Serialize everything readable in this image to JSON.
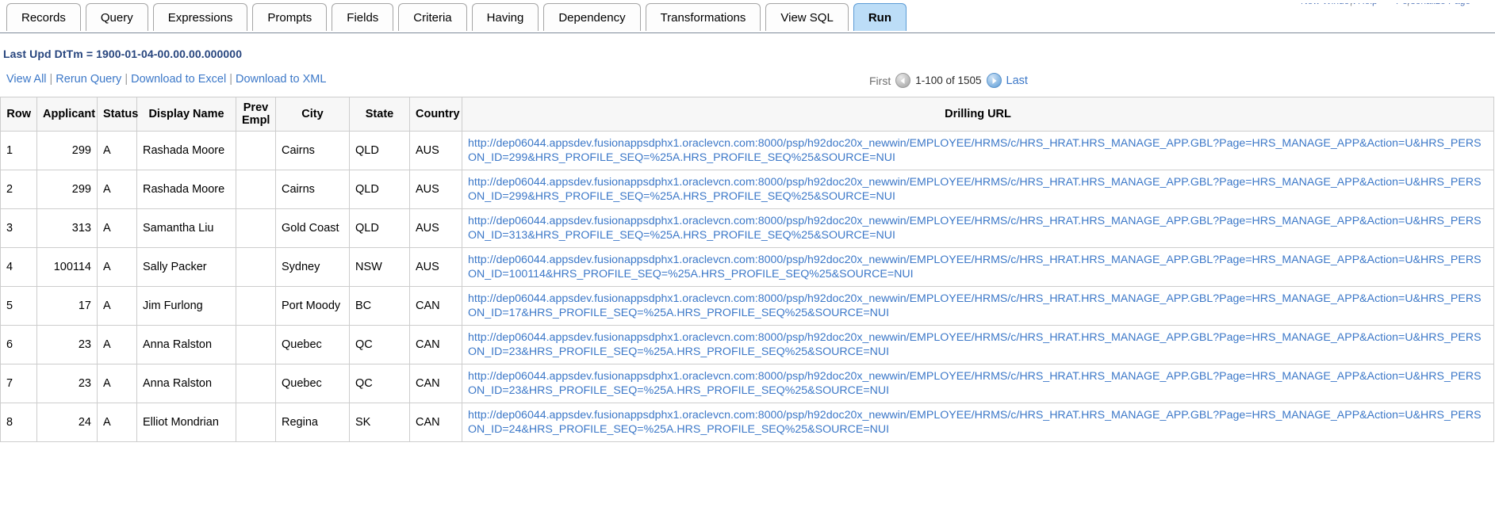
{
  "top_utility": {
    "links": [
      "New Window",
      "Help",
      "Personalize Page"
    ],
    "separator": "|"
  },
  "tabs": [
    {
      "label": "Records",
      "active": false
    },
    {
      "label": "Query",
      "active": false
    },
    {
      "label": "Expressions",
      "active": false
    },
    {
      "label": "Prompts",
      "active": false
    },
    {
      "label": "Fields",
      "active": false
    },
    {
      "label": "Criteria",
      "active": false
    },
    {
      "label": "Having",
      "active": false
    },
    {
      "label": "Dependency",
      "active": false
    },
    {
      "label": "Transformations",
      "active": false
    },
    {
      "label": "View SQL",
      "active": false
    },
    {
      "label": "Run",
      "active": true
    }
  ],
  "status_line": "Last Upd DtTm = 1900-01-04-00.00.00.000000",
  "actions": {
    "separator": "|",
    "links": [
      {
        "label": "View All",
        "name": "view-all-link"
      },
      {
        "label": "Rerun Query",
        "name": "rerun-query-link"
      },
      {
        "label": "Download to Excel",
        "name": "download-excel-link"
      },
      {
        "label": "Download to XML",
        "name": "download-xml-link"
      }
    ]
  },
  "pager": {
    "first_label": "First",
    "prev_icon": "prev-arrow-icon",
    "range_label": "1-100 of 1505",
    "next_icon": "next-arrow-icon",
    "last_label": "Last"
  },
  "table": {
    "headers": [
      "Row",
      "Applicant",
      "Status",
      "Display Name",
      "Prev Empl",
      "City",
      "State",
      "Country",
      "Drilling URL"
    ],
    "rows": [
      {
        "row": "1",
        "applicant": "299",
        "status": "A",
        "display_name": "Rashada Moore",
        "prev_empl": "",
        "city": "Cairns",
        "state": "QLD",
        "country": "AUS",
        "url": "http://dep06044.appsdev.fusionappsdphx1.oraclevcn.com:8000/psp/h92doc20x_newwin/EMPLOYEE/HRMS/c/HRS_HRAT.HRS_MANAGE_APP.GBL?Page=HRS_MANAGE_APP&Action=U&HRS_PERSON_ID=299&HRS_PROFILE_SEQ=%25A.HRS_PROFILE_SEQ%25&SOURCE=NUI"
      },
      {
        "row": "2",
        "applicant": "299",
        "status": "A",
        "display_name": "Rashada Moore",
        "prev_empl": "",
        "city": "Cairns",
        "state": "QLD",
        "country": "AUS",
        "url": "http://dep06044.appsdev.fusionappsdphx1.oraclevcn.com:8000/psp/h92doc20x_newwin/EMPLOYEE/HRMS/c/HRS_HRAT.HRS_MANAGE_APP.GBL?Page=HRS_MANAGE_APP&Action=U&HRS_PERSON_ID=299&HRS_PROFILE_SEQ=%25A.HRS_PROFILE_SEQ%25&SOURCE=NUI"
      },
      {
        "row": "3",
        "applicant": "313",
        "status": "A",
        "display_name": "Samantha Liu",
        "prev_empl": "",
        "city": "Gold Coast",
        "state": "QLD",
        "country": "AUS",
        "url": "http://dep06044.appsdev.fusionappsdphx1.oraclevcn.com:8000/psp/h92doc20x_newwin/EMPLOYEE/HRMS/c/HRS_HRAT.HRS_MANAGE_APP.GBL?Page=HRS_MANAGE_APP&Action=U&HRS_PERSON_ID=313&HRS_PROFILE_SEQ=%25A.HRS_PROFILE_SEQ%25&SOURCE=NUI"
      },
      {
        "row": "4",
        "applicant": "100114",
        "status": "A",
        "display_name": "Sally Packer",
        "prev_empl": "",
        "city": "Sydney",
        "state": "NSW",
        "country": "AUS",
        "url": "http://dep06044.appsdev.fusionappsdphx1.oraclevcn.com:8000/psp/h92doc20x_newwin/EMPLOYEE/HRMS/c/HRS_HRAT.HRS_MANAGE_APP.GBL?Page=HRS_MANAGE_APP&Action=U&HRS_PERSON_ID=100114&HRS_PROFILE_SEQ=%25A.HRS_PROFILE_SEQ%25&SOURCE=NUI"
      },
      {
        "row": "5",
        "applicant": "17",
        "status": "A",
        "display_name": "Jim Furlong",
        "prev_empl": "",
        "city": "Port Moody",
        "state": "BC",
        "country": "CAN",
        "url": "http://dep06044.appsdev.fusionappsdphx1.oraclevcn.com:8000/psp/h92doc20x_newwin/EMPLOYEE/HRMS/c/HRS_HRAT.HRS_MANAGE_APP.GBL?Page=HRS_MANAGE_APP&Action=U&HRS_PERSON_ID=17&HRS_PROFILE_SEQ=%25A.HRS_PROFILE_SEQ%25&SOURCE=NUI"
      },
      {
        "row": "6",
        "applicant": "23",
        "status": "A",
        "display_name": "Anna Ralston",
        "prev_empl": "",
        "city": "Quebec",
        "state": "QC",
        "country": "CAN",
        "url": "http://dep06044.appsdev.fusionappsdphx1.oraclevcn.com:8000/psp/h92doc20x_newwin/EMPLOYEE/HRMS/c/HRS_HRAT.HRS_MANAGE_APP.GBL?Page=HRS_MANAGE_APP&Action=U&HRS_PERSON_ID=23&HRS_PROFILE_SEQ=%25A.HRS_PROFILE_SEQ%25&SOURCE=NUI"
      },
      {
        "row": "7",
        "applicant": "23",
        "status": "A",
        "display_name": "Anna Ralston",
        "prev_empl": "",
        "city": "Quebec",
        "state": "QC",
        "country": "CAN",
        "url": "http://dep06044.appsdev.fusionappsdphx1.oraclevcn.com:8000/psp/h92doc20x_newwin/EMPLOYEE/HRMS/c/HRS_HRAT.HRS_MANAGE_APP.GBL?Page=HRS_MANAGE_APP&Action=U&HRS_PERSON_ID=23&HRS_PROFILE_SEQ=%25A.HRS_PROFILE_SEQ%25&SOURCE=NUI"
      },
      {
        "row": "8",
        "applicant": "24",
        "status": "A",
        "display_name": "Elliot Mondrian",
        "prev_empl": "",
        "city": "Regina",
        "state": "SK",
        "country": "CAN",
        "url": "http://dep06044.appsdev.fusionappsdphx1.oraclevcn.com:8000/psp/h92doc20x_newwin/EMPLOYEE/HRMS/c/HRS_HRAT.HRS_MANAGE_APP.GBL?Page=HRS_MANAGE_APP&Action=U&HRS_PERSON_ID=24&HRS_PROFILE_SEQ=%25A.HRS_PROFILE_SEQ%25&SOURCE=NUI"
      }
    ]
  },
  "colors": {
    "link": "#3c78c8",
    "status_text": "#27457e",
    "active_tab_bg": "#bcddf7",
    "active_tab_border": "#5b9bd5",
    "header_bg": "#f7f7f7",
    "grid_border": "#cdcdcd"
  }
}
